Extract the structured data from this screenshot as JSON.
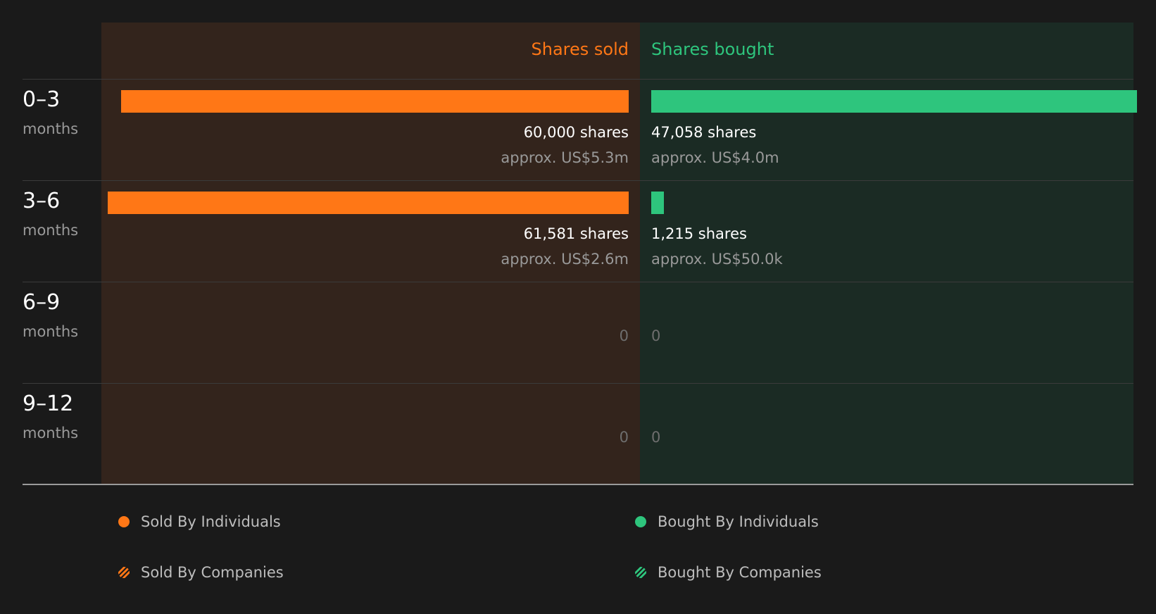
{
  "colors": {
    "sold": "#ff7716",
    "bought": "#2ec57d",
    "sold_panel": "#33241c",
    "bought_panel": "#1b2b24",
    "background": "#1a1a1a"
  },
  "chart_data": {
    "type": "bar",
    "orientation": "horizontal-diverging",
    "columns": {
      "sold": "Shares sold",
      "bought": "Shares bought"
    },
    "rows": [
      {
        "range": "0–3",
        "unit": "months",
        "sold": 60000,
        "sold_label": "60,000 shares",
        "sold_value": "approx. US$5.3m",
        "bought": 47058,
        "bought_label": "47,058 shares",
        "bought_value": "approx. US$4.0m"
      },
      {
        "range": "3–6",
        "unit": "months",
        "sold": 61581,
        "sold_label": "61,581 shares",
        "sold_value": "approx. US$2.6m",
        "bought": 1215,
        "bought_label": "1,215 shares",
        "bought_value": "approx. US$50.0k"
      },
      {
        "range": "6–9",
        "unit": "months",
        "sold": 0,
        "sold_label": "0",
        "sold_value": "",
        "bought": 0,
        "bought_label": "0",
        "bought_value": ""
      },
      {
        "range": "9–12",
        "unit": "months",
        "sold": 0,
        "sold_label": "0",
        "sold_value": "",
        "bought": 0,
        "bought_label": "0",
        "bought_value": ""
      }
    ],
    "legend": [
      {
        "label": "Sold By Individuals",
        "style": "solid",
        "side": "sold"
      },
      {
        "label": "Bought By Individuals",
        "style": "solid",
        "side": "bought"
      },
      {
        "label": "Sold By Companies",
        "style": "hatched",
        "side": "sold"
      },
      {
        "label": "Bought By Companies",
        "style": "hatched",
        "side": "bought"
      }
    ]
  }
}
